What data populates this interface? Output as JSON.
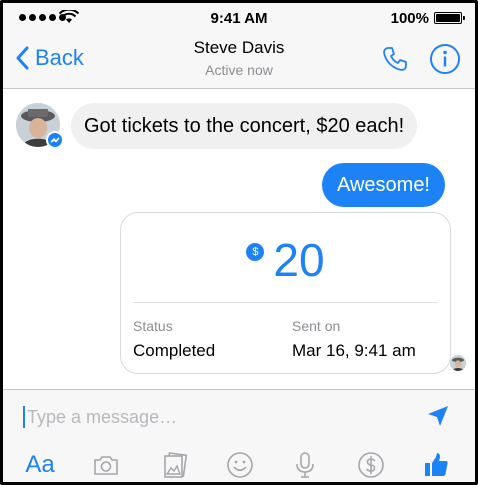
{
  "status_bar": {
    "time": "9:41 AM",
    "battery": "100%"
  },
  "nav": {
    "back_label": "Back",
    "contact_name": "Steve Davis",
    "contact_status": "Active now"
  },
  "messages": {
    "incoming": "Got tickets to the concert, $20 each!",
    "outgoing": "Awesome!"
  },
  "payment": {
    "currency_symbol": "$",
    "amount": "20",
    "status_label": "Status",
    "status_value": "Completed",
    "sent_label": "Sent on",
    "sent_value": "Mar 16, 9:41 am"
  },
  "composer": {
    "placeholder": "Type a message…",
    "aa_label": "Aa"
  },
  "colors": {
    "accent": "#1e82f7",
    "bubble_in": "#f0f0f0"
  },
  "icons": [
    "back-chevron-icon",
    "phone-icon",
    "info-icon",
    "send-icon",
    "camera-icon",
    "gallery-icon",
    "emoji-icon",
    "microphone-icon",
    "payment-icon",
    "like-icon"
  ]
}
